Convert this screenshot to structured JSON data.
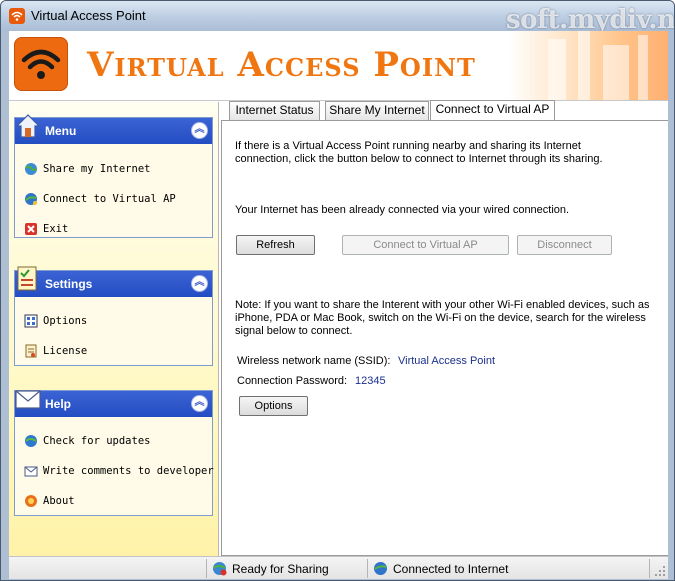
{
  "window": {
    "title": "Virtual Access Point",
    "watermark": "soft.mydiv.net"
  },
  "banner": {
    "title": "Virtual Access Point"
  },
  "sidebar": {
    "groups": [
      {
        "title": "Menu",
        "items": [
          {
            "label": "Share my Internet",
            "icon": "share-globe-icon"
          },
          {
            "label": "Connect to Virtual AP",
            "icon": "connect-globe-icon"
          },
          {
            "label": "Exit",
            "icon": "exit-x-icon"
          }
        ]
      },
      {
        "title": "Settings",
        "items": [
          {
            "label": "Options",
            "icon": "options-grid-icon"
          },
          {
            "label": "License",
            "icon": "license-icon"
          }
        ]
      },
      {
        "title": "Help",
        "items": [
          {
            "label": "Check for updates",
            "icon": "update-globe-icon"
          },
          {
            "label": "Write comments to developer",
            "icon": "envelope-icon"
          },
          {
            "label": "About",
            "icon": "about-icon"
          }
        ]
      }
    ]
  },
  "tabs": [
    {
      "label": "Internet Status"
    },
    {
      "label": "Share My Internet"
    },
    {
      "label": "Connect to Virtual AP"
    }
  ],
  "content": {
    "intro": "If there is a Virtual Access Point running nearby and sharing its Internet connection, click the button below to connect to Internet through its sharing.",
    "status": "Your Internet has been already connected via your wired connection.",
    "buttons": {
      "refresh": "Refresh",
      "connect": "Connect to Virtual AP",
      "disconnect": "Disconnect",
      "options": "Options"
    },
    "note": "Note: If you want to share the Interent with your other Wi-Fi enabled devices, such as iPhone, PDA or Mac Book, switch on the Wi-Fi on the device, search for the wireless signal below to connect.",
    "ssid_label": "Wireless network name (SSID):",
    "ssid_value": "Virtual Access Point",
    "password_label": "Connection Password:",
    "password_value": "12345"
  },
  "statusbar": {
    "sharing": "Ready for Sharing",
    "internet": "Connected to Internet"
  },
  "colors": {
    "accent": "#f07612",
    "group_header": "#2d55c8",
    "panel_bg": "#fff8c0",
    "value_text": "#1a2f8c"
  }
}
